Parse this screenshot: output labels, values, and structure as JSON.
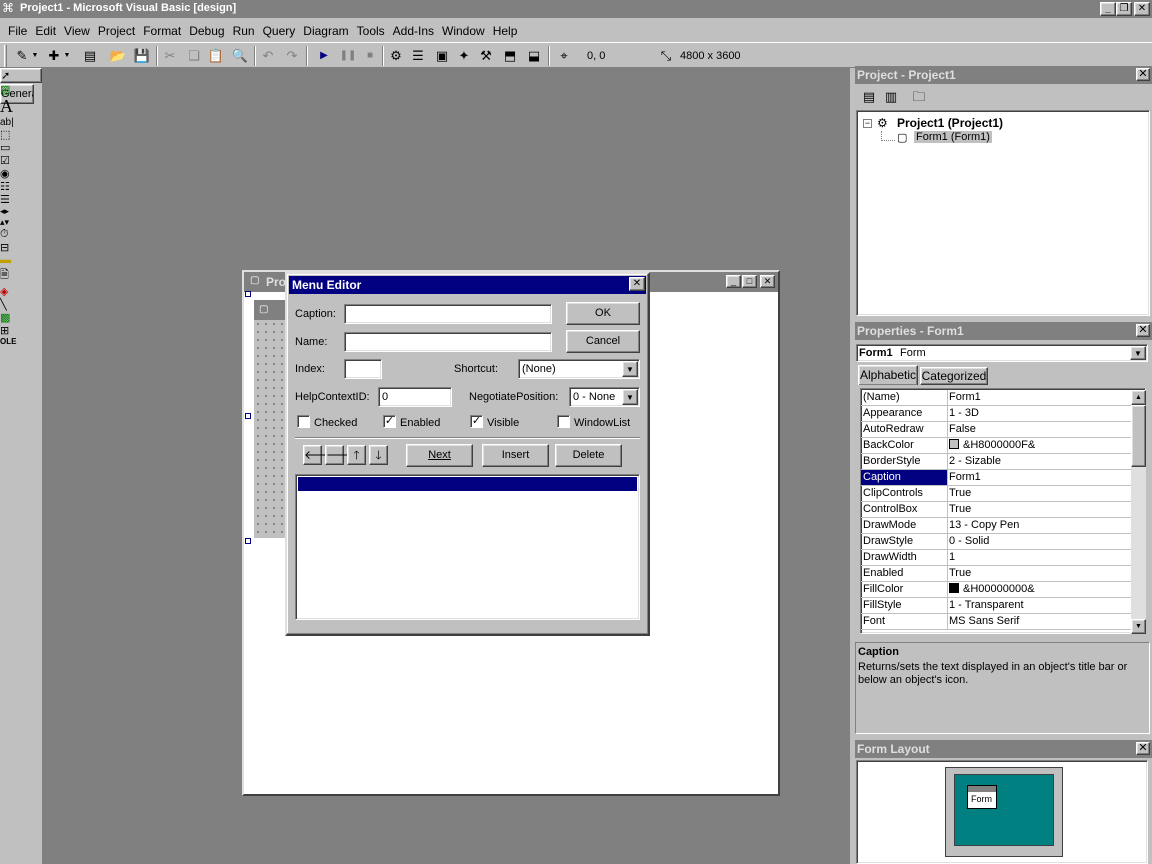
{
  "app": {
    "title": "Project1 - Microsoft Visual Basic [design]"
  },
  "menubar": [
    "File",
    "Edit",
    "View",
    "Project",
    "Format",
    "Debug",
    "Run",
    "Query",
    "Diagram",
    "Tools",
    "Add-Ins",
    "Window",
    "Help"
  ],
  "toolbar": {
    "position": "0, 0",
    "size": "4800 x 3600"
  },
  "toolbox": {
    "tab_label": "General"
  },
  "form": {
    "title_partial": "Pro"
  },
  "menu_editor": {
    "title": "Menu Editor",
    "caption_label": "Caption:",
    "caption_value": "",
    "name_label": "Name:",
    "name_value": "",
    "index_label": "Index:",
    "index_value": "",
    "shortcut_label": "Shortcut:",
    "shortcut_value": "(None)",
    "helpcontext_label": "HelpContextID:",
    "helpcontext_value": "0",
    "negotiate_label": "NegotiatePosition:",
    "negotiate_value": "0 - None",
    "checked_label": "Checked",
    "checked": false,
    "enabled_label": "Enabled",
    "enabled": true,
    "visible_label": "Visible",
    "visible": true,
    "windowlist_label": "WindowList",
    "windowlist": false,
    "ok_label": "OK",
    "cancel_label": "Cancel",
    "next_label": "Next",
    "insert_label": "Insert",
    "delete_label": "Delete"
  },
  "project_panel": {
    "title": "Project - Project1",
    "root": "Project1 (Project1)",
    "child": "Form1 (Form1)"
  },
  "properties_panel": {
    "title": "Properties - Form1",
    "object_name": "Form1",
    "object_type": "Form",
    "tab_alphabetic": "Alphabetic",
    "tab_categorized": "Categorized",
    "rows": [
      {
        "name": "(Name)",
        "value": "Form1"
      },
      {
        "name": "Appearance",
        "value": "1 - 3D"
      },
      {
        "name": "AutoRedraw",
        "value": "False"
      },
      {
        "name": "BackColor",
        "value": "&H8000000F&",
        "swatch": "#c0c0c0"
      },
      {
        "name": "BorderStyle",
        "value": "2 - Sizable"
      },
      {
        "name": "Caption",
        "value": "Form1"
      },
      {
        "name": "ClipControls",
        "value": "True"
      },
      {
        "name": "ControlBox",
        "value": "True"
      },
      {
        "name": "DrawMode",
        "value": "13 - Copy Pen"
      },
      {
        "name": "DrawStyle",
        "value": "0 - Solid"
      },
      {
        "name": "DrawWidth",
        "value": "1"
      },
      {
        "name": "Enabled",
        "value": "True"
      },
      {
        "name": "FillColor",
        "value": "&H00000000&",
        "swatch": "#000000"
      },
      {
        "name": "FillStyle",
        "value": "1 - Transparent"
      },
      {
        "name": "Font",
        "value": "MS Sans Serif"
      }
    ],
    "selected_row": "Caption",
    "desc_title": "Caption",
    "desc_text": "Returns/sets the text displayed in an object's title bar or below an object's icon."
  },
  "layout_panel": {
    "title": "Form Layout",
    "form_label": "Form"
  },
  "colors": {
    "desktop_gray": "#808080",
    "face": "#c0c0c0",
    "active_title": "#000080",
    "selection": "#000080",
    "layout_screen": "#008080"
  }
}
